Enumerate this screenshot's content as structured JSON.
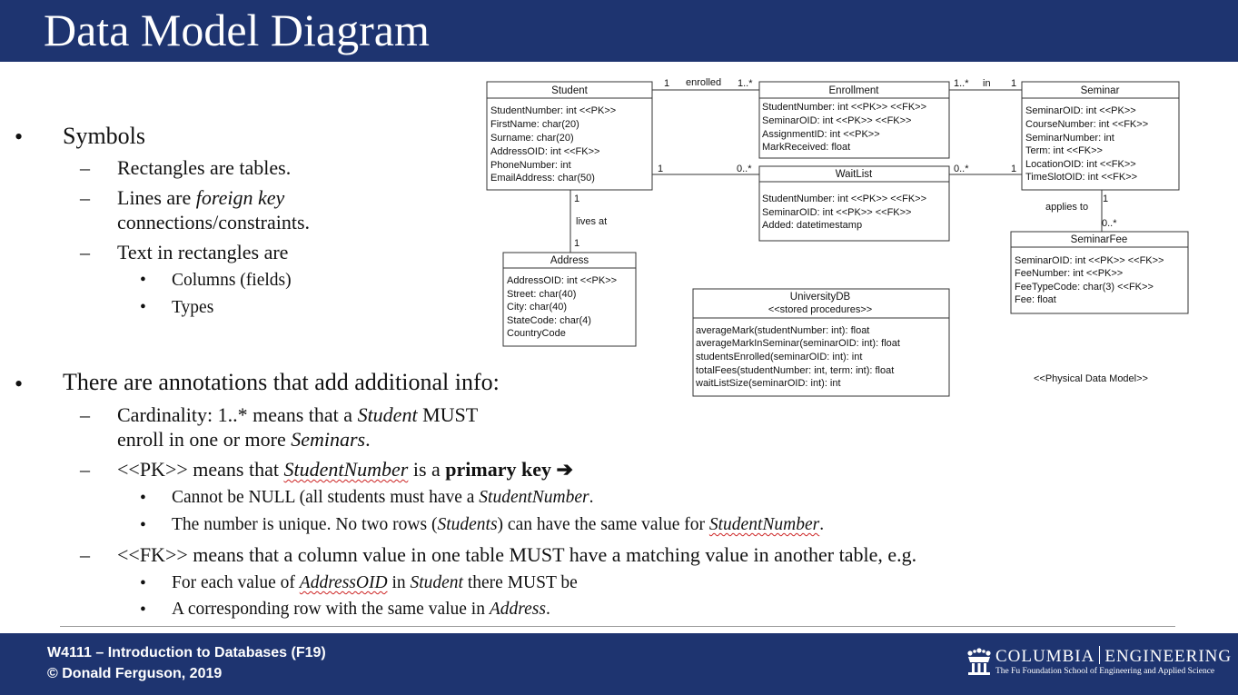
{
  "title": "Data Model Diagram",
  "bullets": {
    "symbols": "Symbols",
    "rect_tables": "Rectangles are tables.",
    "lines_pre": "Lines are ",
    "lines_em": "foreign key",
    "lines_cont": "connections/constraints.",
    "text_in_rect": "Text in rectangles are",
    "columns": "Columns (fields)",
    "types": "Types",
    "annotations": "There are annotations that add additional info:",
    "card_pre": "Cardinality: 1..* means that a ",
    "card_em": "Student",
    "card_post": " MUST",
    "card_cont_pre": "enroll in one or more ",
    "card_cont_em": "Seminars",
    "card_cont_post": ".",
    "pk_pre": "<<PK>> means that ",
    "pk_em": "StudentNumber",
    "pk_mid": " is a ",
    "pk_bold": "primary key",
    "pk_arrow": "➔",
    "null_pre": "Cannot be NULL (all students must have a ",
    "null_em": "StudentNumber",
    "null_post": ".",
    "unique_pre": "The number is unique. No two rows (",
    "unique_em": "Students",
    "unique_mid": ") can have the same value for ",
    "unique_em2": "StudentNumber",
    "unique_post": ".",
    "fk": "<<FK>> means that a column value in one table MUST have a matching value in another table, e.g.",
    "each_pre": "For each value of ",
    "each_em": "AddressOID",
    "each_mid": " in ",
    "each_em2": "Student",
    "each_post": " there MUST be",
    "corr_pre": "A corresponding row with the same value in ",
    "corr_em": "Address",
    "corr_post": "."
  },
  "marks": {
    "dot": "•",
    "dash": "–"
  },
  "diagram": {
    "tables": [
      {
        "id": "student",
        "name": "Student",
        "fields": [
          "StudentNumber: int <<PK>>",
          "FirstName: char(20)",
          "Surname: char(20)",
          "AddressOID: int <<FK>>",
          "PhoneNumber: int",
          "EmailAddress: char(50)"
        ]
      },
      {
        "id": "enrollment",
        "name": "Enrollment",
        "fields": [
          "StudentNumber: int <<PK>> <<FK>>",
          "SeminarOID: int <<PK>> <<FK>>",
          "AssignmentID: int <<PK>>",
          "MarkReceived: float"
        ]
      },
      {
        "id": "seminar",
        "name": "Seminar",
        "fields": [
          "SeminarOID: int <<PK>>",
          "CourseNumber: int <<FK>>",
          "SeminarNumber: int",
          "Term: int <<FK>>",
          "LocationOID: int <<FK>>",
          "TimeSlotOID: int <<FK>>"
        ]
      },
      {
        "id": "waitlist",
        "name": "WaitList",
        "fields": [
          "StudentNumber: int <<PK>> <<FK>>",
          "SeminarOID: int <<PK>> <<FK>>",
          "Added: datetimestamp"
        ]
      },
      {
        "id": "seminarfee",
        "name": "SeminarFee",
        "fields": [
          "SeminarOID: int <<PK>> <<FK>>",
          "FeeNumber: int <<PK>>",
          "FeeTypeCode: char(3) <<FK>>",
          "Fee: float"
        ]
      },
      {
        "id": "address",
        "name": "Address",
        "fields": [
          "AddressOID: int <<PK>>",
          "Street: char(40)",
          "City: char(40)",
          "StateCode: char(4)",
          "CountryCode"
        ]
      },
      {
        "id": "universitydb",
        "name": "UniversityDB",
        "stereotype": "<<stored procedures>>",
        "fields": [
          "averageMark(studentNumber: int): float",
          "averageMarkInSeminar(seminarOID: int): float",
          "studentsEnrolled(seminarOID: int): int",
          "totalFees(studentNumber: int, term: int): float",
          "waitListSize(seminarOID: int): int"
        ]
      }
    ],
    "labels": {
      "enrolled": "enrolled",
      "in": "in",
      "lives_at": "lives at",
      "applies_to": "applies to",
      "one": "1",
      "one_many": "1..*",
      "zero_many": "0..*",
      "physical": "<<Physical Data Model>>"
    }
  },
  "footer": {
    "course": "W4111 – Introduction to Databases (F19)",
    "copyright": "© Donald Ferguson, 2019",
    "logo_left": "COLUMBIA",
    "logo_right": "ENGINEERING",
    "logo_sub": "The Fu Foundation School of Engineering and Applied Science"
  },
  "colors": {
    "header": "#1e3470",
    "footer": "#1e3470",
    "underline": "#cc2222"
  }
}
